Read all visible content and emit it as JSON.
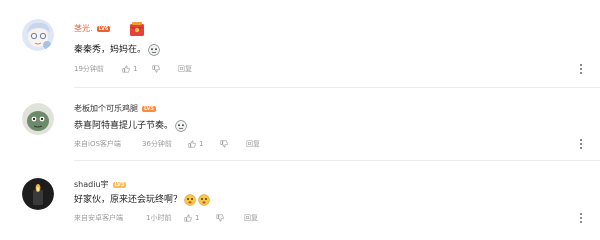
{
  "comments": [
    {
      "username": "茎光.",
      "badge": "LV6",
      "badge_color": "#f25d2e",
      "username_color": "#f25d2e",
      "content": "秦秦秀，妈妈在。",
      "emoji_count": 1,
      "time": "19分钟前",
      "client": "",
      "likes": "1",
      "reply_label": "回复"
    },
    {
      "username": "老板加个可乐鸡腿",
      "badge": "LV5",
      "badge_color": "#ff8a3d",
      "username_color": "#333333",
      "content": "恭喜阿特喜提儿子节奏。",
      "emoji_count": 1,
      "time": "36分钟前",
      "client": "来自iOS客户端",
      "likes": "1",
      "reply_label": "回复"
    },
    {
      "username": "shadiu宇",
      "badge": "LV3",
      "badge_color": "#ffb85a",
      "username_color": "#333333",
      "content": "好家伙，原来还会玩终啊？",
      "emoji_count": 2,
      "time": "1小时前",
      "client": "来自安卓客户端",
      "likes": "1",
      "reply_label": "回复"
    }
  ],
  "icons": {
    "like": "thumb-up-icon",
    "dislike": "thumb-down-icon",
    "more": "more-vertical-icon",
    "gift": "red-envelope-icon"
  },
  "colors": {
    "divider": "#ececec",
    "meta_text": "#9a9a9a",
    "accent": "#f25d2e"
  }
}
